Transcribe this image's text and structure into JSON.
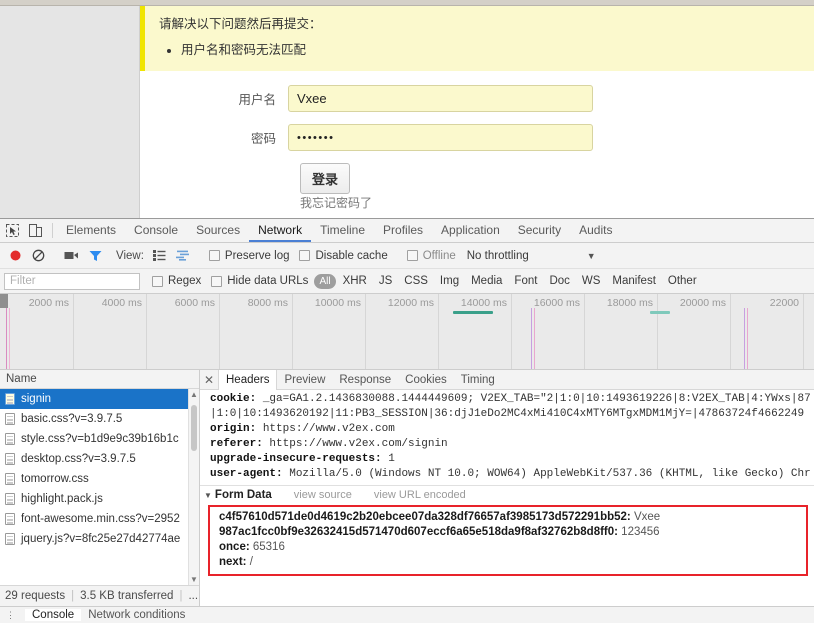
{
  "webpage": {
    "alert": {
      "title": "请解决以下问题然后再提交：",
      "items": [
        "用户名和密码无法匹配"
      ]
    },
    "form": {
      "username_label": "用户名",
      "username_value": "Vxee",
      "password_label": "密码",
      "password_value": "•••••••",
      "submit_label": "登录",
      "forgot_label": "我忘记密码了"
    }
  },
  "devtools": {
    "icons": {
      "inspect": "inspect-cursor-icon",
      "device": "device-toolbar-icon"
    },
    "tabs": [
      {
        "label": "Elements",
        "active": false
      },
      {
        "label": "Console",
        "active": false
      },
      {
        "label": "Sources",
        "active": false
      },
      {
        "label": "Network",
        "active": true
      },
      {
        "label": "Timeline",
        "active": false
      },
      {
        "label": "Profiles",
        "active": false
      },
      {
        "label": "Application",
        "active": false
      },
      {
        "label": "Security",
        "active": false
      },
      {
        "label": "Audits",
        "active": false
      }
    ],
    "controls": {
      "record": "record-icon",
      "clear": "clear-icon",
      "capture_screenshots": "camera-icon",
      "filter_toggle": "funnel-icon",
      "view_label": "View:",
      "view_list_icon": "list-view-icon",
      "view_waterfall_icon": "waterfall-view-icon",
      "preserve_log": "Preserve log",
      "disable_cache": "Disable cache",
      "offline": "Offline",
      "throttling": "No throttling"
    },
    "filter": {
      "placeholder": "Filter",
      "value": "",
      "regex_label": "Regex",
      "hide_data_urls_label": "Hide data URLs",
      "types": [
        "All",
        "XHR",
        "JS",
        "CSS",
        "Img",
        "Media",
        "Font",
        "Doc",
        "WS",
        "Manifest",
        "Other"
      ],
      "active_type": "All"
    },
    "overview": {
      "ticks": [
        "2000 ms",
        "4000 ms",
        "6000 ms",
        "8000 ms",
        "10000 ms",
        "12000 ms",
        "14000 ms",
        "16000 ms",
        "18000 ms",
        "20000 ms",
        "22000"
      ]
    },
    "requests": {
      "column_header": "Name",
      "rows": [
        {
          "name": "signin",
          "selected": true
        },
        {
          "name": "basic.css?v=3.9.7.5",
          "selected": false
        },
        {
          "name": "style.css?v=b1d9e9c39b16b1c",
          "selected": false
        },
        {
          "name": "desktop.css?v=3.9.7.5",
          "selected": false
        },
        {
          "name": "tomorrow.css",
          "selected": false
        },
        {
          "name": "highlight.pack.js",
          "selected": false
        },
        {
          "name": "font-awesome.min.css?v=2952",
          "selected": false
        },
        {
          "name": "jquery.js?v=8fc25e27d42774ae",
          "selected": false
        }
      ],
      "summary_requests": "29 requests",
      "summary_transferred": "3.5 KB transferred",
      "summary_more": "..."
    },
    "detail": {
      "close_icon": "close-icon",
      "tabs": [
        {
          "label": "Headers",
          "active": true
        },
        {
          "label": "Preview",
          "active": false
        },
        {
          "label": "Response",
          "active": false
        },
        {
          "label": "Cookies",
          "active": false
        },
        {
          "label": "Timing",
          "active": false
        }
      ],
      "headers": [
        {
          "key": "cookie:",
          "value": " _ga=GA1.2.1436830088.1444449609; V2EX_TAB=\"2|1:0|10:1493619226|8:V2EX_TAB|4:YWxs|87"
        },
        {
          "key": "",
          "value": "|1:0|10:1493620192|11:PB3_SESSION|36:djJ1eDo2MC4xMi410C4xMTY6MTgxMDM1MjY=|47863724f4662249"
        },
        {
          "key": "origin:",
          "value": " https://www.v2ex.com"
        },
        {
          "key": "referer:",
          "value": " https://www.v2ex.com/signin"
        },
        {
          "key": "upgrade-insecure-requests:",
          "value": " 1"
        },
        {
          "key": "user-agent:",
          "value": " Mozilla/5.0 (Windows NT 10.0; WOW64) AppleWebKit/537.36 (KHTML, like Gecko) Chr"
        }
      ],
      "form_data": {
        "title": "Form Data",
        "view_source": "view source",
        "view_url_encoded": "view URL encoded",
        "highlight_color": "#e8232a",
        "entries": [
          {
            "key": "c4f57610d571de0d4619c2b20ebcee07da328df76657af3985173d572291bb52:",
            "value": "Vxee"
          },
          {
            "key": "987ac1fcc0bf9e32632415d571470d607eccf6a65e518da9f8af32762b8d8ff0:",
            "value": "123456"
          },
          {
            "key": "once:",
            "value": "65316"
          },
          {
            "key": "next:",
            "value": "/"
          }
        ]
      }
    },
    "drawer": {
      "menu_icon": "more-vertical-icon",
      "tabs": [
        {
          "label": "Console",
          "active": true
        },
        {
          "label": "Network conditions",
          "active": false
        }
      ]
    }
  }
}
